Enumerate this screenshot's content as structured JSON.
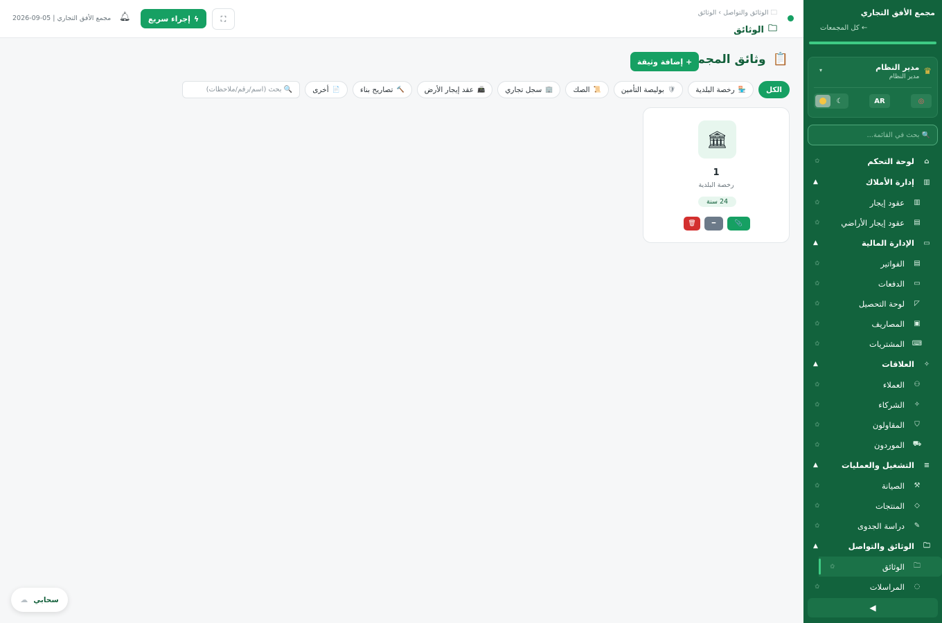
{
  "sidebar": {
    "brand_title": "مجمع الأفق التجاري",
    "back_link": "← كل المجمعات",
    "user": {
      "name": "مدير النظام",
      "role": "مدير النظام",
      "caret": "▾"
    },
    "lang_label": "AR",
    "search_placeholder": "🔍 بحث في القائمة...",
    "collapse_label": "◀",
    "items": [
      {
        "label": "لوحة التحكم",
        "kind": "section"
      },
      {
        "label": "إدارة الأملاك",
        "kind": "section",
        "expanded": true
      },
      {
        "label": "عقود إيجار",
        "kind": "sub"
      },
      {
        "label": "عقود إيجار الأراضي",
        "kind": "sub"
      },
      {
        "label": "الإدارة المالية",
        "kind": "section",
        "expanded": true
      },
      {
        "label": "الفواتير",
        "kind": "sub"
      },
      {
        "label": "الدفعات",
        "kind": "sub"
      },
      {
        "label": "لوحة التحصيل",
        "kind": "sub"
      },
      {
        "label": "المصاريف",
        "kind": "sub"
      },
      {
        "label": "المشتريات",
        "kind": "sub"
      },
      {
        "label": "العلاقات",
        "kind": "section",
        "expanded": true
      },
      {
        "label": "العملاء",
        "kind": "sub"
      },
      {
        "label": "الشركاء",
        "kind": "sub"
      },
      {
        "label": "المقاولون",
        "kind": "sub"
      },
      {
        "label": "الموردون",
        "kind": "sub"
      },
      {
        "label": "التشغيل والعمليات",
        "kind": "section",
        "expanded": true
      },
      {
        "label": "الصيانة",
        "kind": "sub"
      },
      {
        "label": "المنتجات",
        "kind": "sub"
      },
      {
        "label": "دراسة الجدوى",
        "kind": "sub"
      },
      {
        "label": "الوثائق والتواصل",
        "kind": "section",
        "expanded": true
      },
      {
        "label": "الوثائق",
        "kind": "sub",
        "active": true
      },
      {
        "label": "المراسلات",
        "kind": "sub"
      }
    ]
  },
  "topbar": {
    "breadcrumb_path": "الوثائق والتواصل › الوثائق",
    "page_title": "الوثائق",
    "quick_action_label": "إجراء سريع",
    "date_text": "2026-09-05 | مجمع الأفق التجاري"
  },
  "main": {
    "title": "وثائق المجمع",
    "add_button_label": "+ إضافة وثيقة",
    "filters": [
      {
        "label": "الكل",
        "icon": "",
        "active": true
      },
      {
        "label": "رخصة البلدية",
        "icon": "🏪"
      },
      {
        "label": "بوليصة التأمين",
        "icon": "🛡"
      },
      {
        "label": "الصك",
        "icon": "📜"
      },
      {
        "label": "سجل تجاري",
        "icon": "🏢"
      },
      {
        "label": "عقد إيجار الأرض",
        "icon": "📠"
      },
      {
        "label": "تصاريح بناء",
        "icon": "🔨"
      },
      {
        "label": "أخرى",
        "icon": "📄"
      }
    ],
    "search_placeholder": "🔍 بحث (اسم/رقم/ملاحظات)",
    "document_card": {
      "icon": "🏛",
      "number": "1",
      "type": "رخصة البلدية",
      "duration_badge": "24 سنة"
    }
  },
  "cloud_label": "سحابي"
}
